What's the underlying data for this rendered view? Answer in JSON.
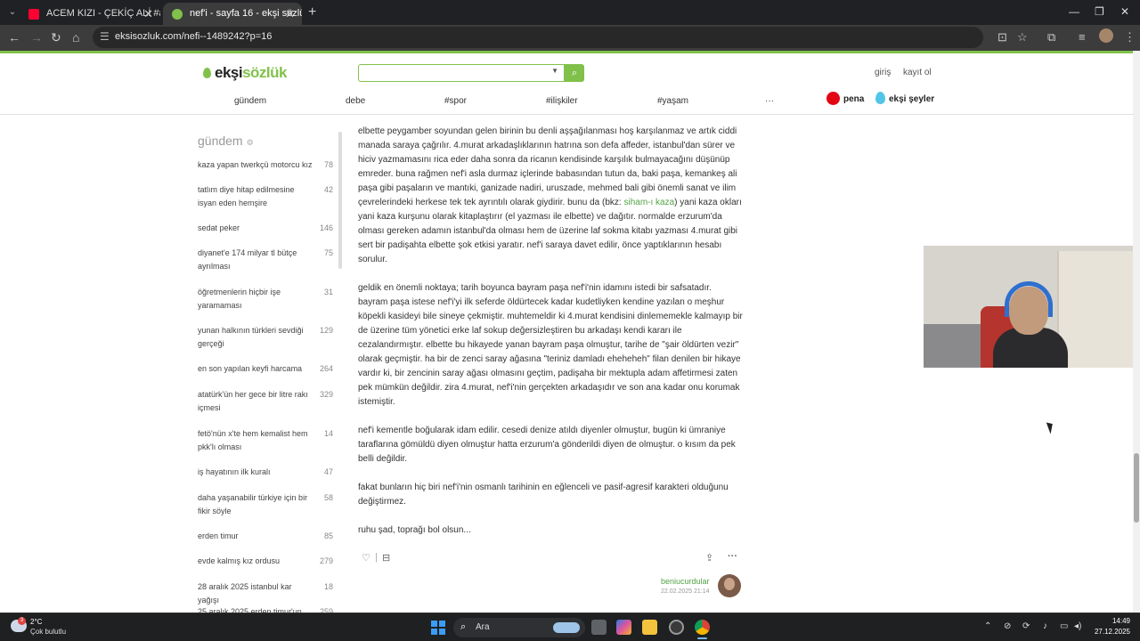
{
  "browser": {
    "tab_menu_icon": "chevron-down-icon",
    "tabs": [
      {
        "title": "ACEM KIZI - ÇEKİÇ ALİ #ac",
        "favicon_color": "#ff0033"
      },
      {
        "title": "nef'i - sayfa 16 - ekşi sözlük",
        "favicon_color": "#81c14b"
      }
    ],
    "url": "eksisozluk.com/nefi--1489242?p=16"
  },
  "site": {
    "logo_prefix": "ekşi",
    "logo_suffix": "sözlük",
    "search_placeholder": "",
    "login": "giriş",
    "register": "kayıt ol",
    "nav": [
      "gündem",
      "debe",
      "#spor",
      "#ilişkiler",
      "#yaşam",
      "···"
    ],
    "pena": "pena",
    "seyler": "ekşi şeyler",
    "accent": "#81c14b"
  },
  "sidebar": {
    "title": "gündem",
    "items": [
      {
        "title": "kaza yapan twerkçü motorcu kız",
        "count": "78"
      },
      {
        "title": "tatlım diye hitap edilmesine isyan eden hemşire",
        "count": "42"
      },
      {
        "title": "sedat peker",
        "count": "146"
      },
      {
        "title": "diyanet'e 174 milyar tl bütçe ayrılması",
        "count": "75"
      },
      {
        "title": "öğretmenlerin hiçbir işe yaramaması",
        "count": "31"
      },
      {
        "title": "yunan halkının türkleri sevdiği gerçeği",
        "count": "129"
      },
      {
        "title": "en son yapılan keyfi harcama",
        "count": "264"
      },
      {
        "title": "atatürk'ün her gece bir litre rakı içmesi",
        "count": "329"
      },
      {
        "title": "fetö'nün x'te hem kemalist hem pkk'lı olması",
        "count": "14"
      },
      {
        "title": "iş hayatının ilk kuralı",
        "count": "47"
      },
      {
        "title": "daha yaşanabilir türkiye için bir fikir söyle",
        "count": "58"
      },
      {
        "title": "erden timur",
        "count": "85"
      },
      {
        "title": "evde kalmış kız ordusu",
        "count": "279"
      },
      {
        "title": "28 aralık 2025 istanbul kar yağışı",
        "count": "18"
      },
      {
        "title": "25 aralık 2025 erden timur'un",
        "count": "259"
      }
    ]
  },
  "entry": {
    "p1_a": "elbette peygamber soyundan gelen birinin bu denli aşşağılanması hoş karşılanmaz ve artık ciddi manada saraya çağrılır. 4.murat arkadaşlıklarının hatrına son defa affeder, istanbul'dan sürer ve hiciv yazmamasını rica eder daha sonra da ricanın kendisinde karşılık bulmayacağını düşünüp emreder. buna rağmen nef'i asla durmaz içlerinde babasından tutun da, baki paşa, kemankeş ali paşa gibi paşaların ve mantıki, ganizade nadiri, uruszade, mehmed bali gibi önemli sanat ve ilim çevrelerindeki herkese tek tek ayrıntılı olarak giydirir. bunu da (bkz: ",
    "p1_link": "siham-ı kaza",
    "p1_b": ") yani kaza okları yani kaza kurşunu olarak kitaplaştırır (el yazması ile elbette) ve dağıtır. normalde erzurum'da olması gereken adamın istanbul'da olması hem de üzerine laf sokma kitabı yazması 4.murat gibi sert bir padişahta elbette şok etkisi yaratır. nef'i saraya davet edilir, önce yaptıklarının hesabı sorulur.",
    "p2": "geldik en önemli noktaya; tarih boyunca bayram paşa nef'i'nin idamını istedi bir safsatadır. bayram paşa istese nef'i'yi ilk seferde öldürtecek kadar kudetliyken kendine yazılan o meşhur köpekli kasideyi bile sineye çekmiştir. muhtemeldir ki 4.murat kendisini dinlememekle kalmayıp bir de üzerine tüm yönetici erke laf sokup değersizleştiren bu arkadaşı kendi kararı ile cezalandırmıştır. elbette bu hikayede yanan bayram paşa olmuştur, tarihe de \"şair öldürten vezir\" olarak geçmiştir. ha bir de zenci saray ağasına \"teriniz damladı eheheheh\" filan denilen bir hikaye vardır ki, bir zencinin saray ağası olmasını geçtim, padişaha bir mektupla adam affetirmesi zaten pek mümkün değildir. zira 4.murat, nef'i'nin gerçekten arkadaşıdır ve son ana kadar onu korumak istemiştir.",
    "p3": "nef'i kementle boğularak idam edilir. cesedi denize atıldı diyenler olmuştur, bugün ki ümraniye taraflarına gömüldü diyen olmuştur hatta erzurum'a gönderildi diyen de olmuştur. o kısım da pek belli değildir.",
    "p4": "fakat bunların hiç biri nef'i'nin osmanlı tarihinin en eğlenceli ve pasif-agresif karakteri olduğunu değiştirmez.",
    "p5": "ruhu şad, toprağı bol olsun...",
    "author": "beniucurdular",
    "date": "22.02.2025 21:14"
  },
  "taskbar": {
    "weather_badge": "3",
    "temperature": "2°C",
    "weather": "Çok bulutlu",
    "search_label": "Ara",
    "time": "14:49",
    "date": "27.12.2025"
  }
}
